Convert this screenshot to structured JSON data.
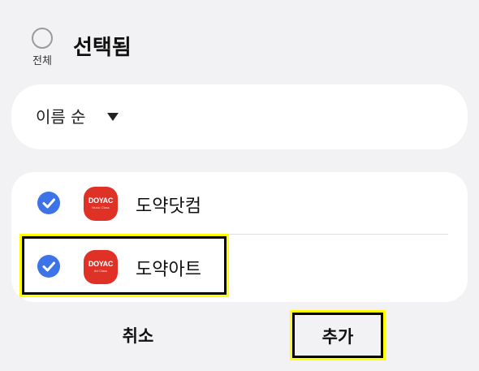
{
  "header": {
    "select_all_label": "전체",
    "title": "선택됨"
  },
  "sort": {
    "label": "이름 순",
    "icon": "dropdown-arrow-icon"
  },
  "apps": [
    {
      "name": "도약닷컴",
      "checked": true,
      "icon_brand": "DOYAC",
      "icon_sub": "Music Class"
    },
    {
      "name": "도약아트",
      "checked": true,
      "icon_brand": "DOYAC",
      "icon_sub": "Art Class"
    }
  ],
  "actions": {
    "cancel_label": "취소",
    "add_label": "추가"
  },
  "colors": {
    "check_blue": "#3d73e8",
    "icon_red": "#e03127",
    "highlight_yellow": "#ffff00"
  }
}
